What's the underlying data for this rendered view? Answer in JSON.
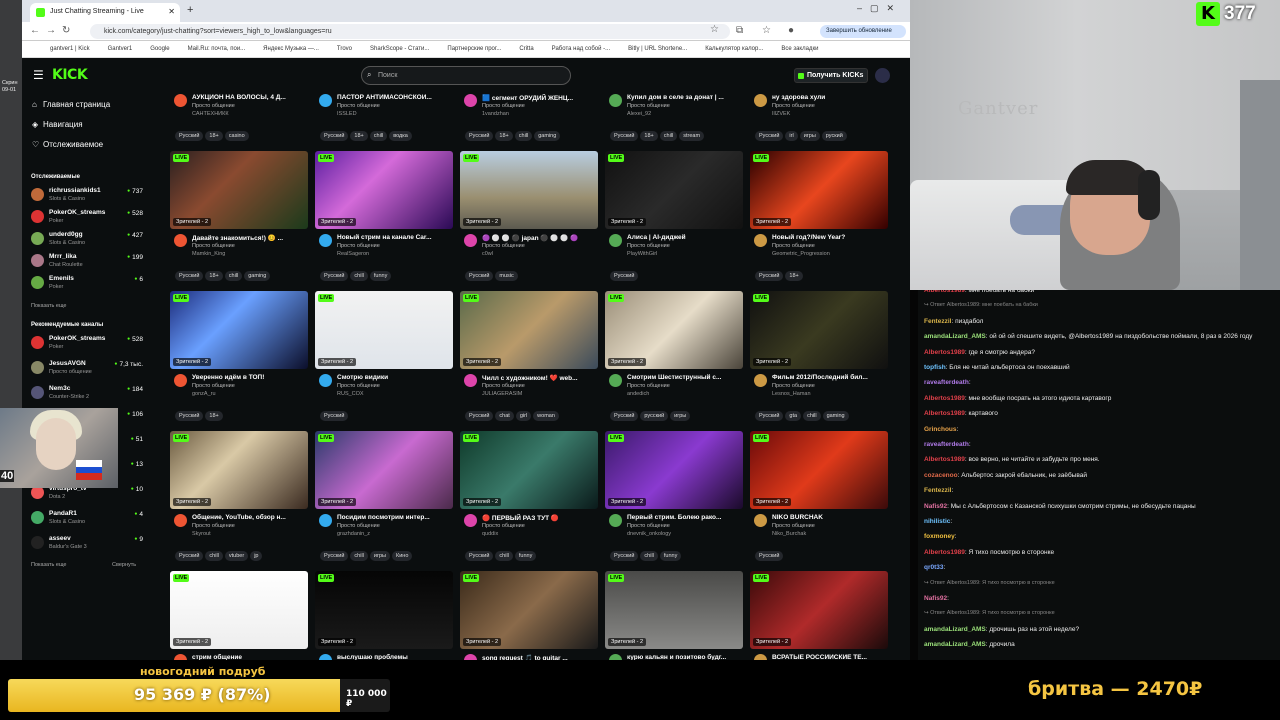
{
  "browser": {
    "tab_title": "Just Chatting Streaming - Live",
    "url": "kick.com/category/just-chatting?sort=viewers_high_to_low&languages=ru",
    "update_button": "Завершить обновление",
    "bookmarks": [
      "gantver1 | Kick",
      "Gantver1",
      "Google",
      "Mail.Ru: почта, пои...",
      "Яндекс Музыка —...",
      "Trovo",
      "SharkScope - Стати...",
      "Партнерские прог...",
      "Critta",
      "Работа над собой -...",
      "Bitly | URL Shortene...",
      "Калькулятор калор...",
      "Все закладки"
    ]
  },
  "kick": {
    "search_placeholder": "Поиск",
    "get_kicks": "Получить KICKs",
    "nav": {
      "home": "Главная страница",
      "browse": "Навигация",
      "following": "Отслеживаемое"
    },
    "following_header": "Отслеживаемые",
    "following": [
      {
        "name": "richrussiankids1",
        "game": "Slots & Casino",
        "viewers": "737",
        "color": "#c06a3a"
      },
      {
        "name": "PokerOK_streams",
        "game": "Poker",
        "viewers": "528",
        "color": "#d33"
      },
      {
        "name": "underd0gg",
        "game": "Slots & Casino",
        "viewers": "427",
        "color": "#7a5"
      },
      {
        "name": "Mrrr_lika",
        "game": "Chat Roulette",
        "viewers": "199",
        "color": "#a78"
      },
      {
        "name": "Emenils",
        "game": "Poker",
        "viewers": "6",
        "color": "#6a4"
      }
    ],
    "show_more": "Показать еще",
    "recommended_header": "Рекомендуемые каналы",
    "recommended": [
      {
        "name": "PokerOK_streams",
        "game": "Poker",
        "viewers": "528",
        "color": "#d33"
      },
      {
        "name": "JesusAVGN",
        "game": "Просто общение",
        "viewers": "7,3 тыс.",
        "color": "#886"
      },
      {
        "name": "Nem3c",
        "game": "Counter-Strike 2",
        "viewers": "184",
        "color": "#557"
      },
      {
        "name": "",
        "game": "",
        "viewers": "106",
        "color": "#444"
      },
      {
        "name": "",
        "game": "",
        "viewers": "51",
        "color": "#444"
      },
      {
        "name": "",
        "game": "",
        "viewers": "13",
        "color": "#444"
      },
      {
        "name": "virtuspro_tv",
        "game": "Dota 2",
        "viewers": "10",
        "color": "#e55"
      },
      {
        "name": "PandaR1",
        "game": "Slots & Casino",
        "viewers": "4",
        "color": "#4a6"
      },
      {
        "name": "asseev",
        "game": "Baldur's Gate 3",
        "viewers": "9",
        "color": "#222"
      }
    ],
    "show_more2": "Показать еще",
    "collapse": "Свернуть",
    "live_label": "LIVE",
    "viewers_label": "Зрителей - 2",
    "category": "Просто общение",
    "top_row": [
      {
        "title": "АУКЦИОН НА ВОЛОСЫ, 4 Д...",
        "user": "САНТЕХНИКК",
        "tags": [
          "Русский",
          "18+",
          "casino"
        ]
      },
      {
        "title": "ПАСТОР АНТИМАСОНСКОЙ...",
        "user": "ISSLED",
        "tags": [
          "Русский",
          "18+",
          "chill",
          "водка"
        ]
      },
      {
        "title": "🟦 сегмент ОРУДИЙ ЖЕНЦ...",
        "user": "1vandzhan",
        "tags": [
          "Русский",
          "18+",
          "chill",
          "gaming"
        ]
      },
      {
        "title": "Купил дом в селе за донат | ...",
        "user": "Alexei_92",
        "tags": [
          "Русский",
          "18+",
          "chill",
          "stream"
        ]
      },
      {
        "title": "ну здорова хули",
        "user": "IllZVEK",
        "tags": [
          "Русский",
          "irl",
          "игры",
          "руский"
        ]
      }
    ],
    "cards": [
      {
        "title": "Давайте знакомиться!) 😊 ...",
        "user": "Mamkin_King",
        "tags": [
          "Русский",
          "18+",
          "chill",
          "gaming"
        ]
      },
      {
        "title": "Новый стрим на канале Car...",
        "user": "RealSageron",
        "tags": [
          "Русский",
          "chill",
          "funny"
        ]
      },
      {
        "title": "🟣 ⚪ ⚪ ⚫ japan ⚫ ⚪ ⚪ 🟣",
        "user": "c0wl",
        "tags": [
          "Русский",
          "music"
        ]
      },
      {
        "title": "Алиса | AI-диджей",
        "user": "PlayWithGirl",
        "tags": [
          "Русский"
        ]
      },
      {
        "title": "Новый год?/New Year?",
        "user": "Geometric_Progression",
        "tags": [
          "Русский",
          "18+"
        ]
      },
      {
        "title": "Уверенно идём в ТОП!",
        "user": "gonzA_ru",
        "tags": [
          "Русский",
          "18+"
        ]
      },
      {
        "title": "Смотрю видики",
        "user": "RUS_COX",
        "tags": [
          "Русский"
        ]
      },
      {
        "title": "Чилл с художником! ❤️ web...",
        "user": "JULIAGERASIM",
        "tags": [
          "Русский",
          "chat",
          "girl",
          "woman"
        ]
      },
      {
        "title": "Смотрим Шестиструнный с...",
        "user": "andedich",
        "tags": [
          "Русский",
          "русский",
          "игры"
        ]
      },
      {
        "title": "Фильм 2012/Последний бил...",
        "user": "Lesnos_Haman",
        "tags": [
          "Русский",
          "gta",
          "chill",
          "gaming"
        ]
      },
      {
        "title": "Общение, YouTube, обзор н...",
        "user": "Skyrout",
        "tags": [
          "Русский",
          "chill",
          "vtuber",
          "jp"
        ]
      },
      {
        "title": "Посидим посмотрим интер...",
        "user": "grazhdanin_z",
        "tags": [
          "Русский",
          "chill",
          "игры",
          "Кино"
        ]
      },
      {
        "title": "🔴 ПЕРВЫЙ РАЗ ТУТ 🔴",
        "user": "quddix",
        "tags": [
          "Русский",
          "chill",
          "funny"
        ]
      },
      {
        "title": "Первый стрим. Болею рако...",
        "user": "dnevnik_onkology",
        "tags": [
          "Русский",
          "chill",
          "funny"
        ]
      },
      {
        "title": "NIKO BURCHAK",
        "user": "Niko_Burchak",
        "tags": [
          "Русский"
        ]
      },
      {
        "title": "стрим общение",
        "user": "",
        "tags": []
      },
      {
        "title": "выслушаю проблемы",
        "user": "",
        "tags": []
      },
      {
        "title": "song request 🎵 to guitar ...",
        "user": "",
        "tags": []
      },
      {
        "title": "курю кальян и позитово будг...",
        "user": "",
        "tags": []
      },
      {
        "title": "ВСРАТЫЕ РОССИЙСКИЕ ТЕ...",
        "user": "",
        "tags": []
      }
    ]
  },
  "overlay": {
    "kicks_count": "377",
    "webcam_text": "Gantver",
    "mini_count": "40",
    "side_label": "Скрин 09-01",
    "goal_title": "новогодний подруб",
    "goal_amount": "95 369 ₽ (87%)",
    "goal_progress": 0.87,
    "goal_target": "110 000 ₽",
    "promo": "бритва — 2470₽"
  },
  "chat": [
    {
      "user": "Albertos1989",
      "color": "#e0404a",
      "text": ": мне поебать на бабки",
      "reply": false
    },
    {
      "user": "",
      "color": "#888",
      "text": "↪ Ответ Albertos1989: мне поебать на бабки",
      "reply": true
    },
    {
      "user": "Fentezzil",
      "color": "#d8b34a",
      "text": ": пиздабол",
      "reply": false
    },
    {
      "user": "amandaLizard_AMS",
      "color": "#9be07a",
      "text": ": ой ой ой спешите видеть, @Albertos1989 на пиздобольстве поймали, 8 раз в 2026 году",
      "reply": false
    },
    {
      "user": "Albertos1989",
      "color": "#e0404a",
      "text": ": где я смотрю андера?",
      "reply": false
    },
    {
      "user": "topfish",
      "color": "#6ec3ff",
      "text": ": Бля не читай альбертоса он поехавший",
      "reply": false
    },
    {
      "user": "raveafterdeath",
      "color": "#b07ae8",
      "text": ":",
      "reply": false
    },
    {
      "user": "Albertos1989",
      "color": "#e0404a",
      "text": ": мне вообще посрать на этого идиота картавогр",
      "reply": false
    },
    {
      "user": "Albertos1989",
      "color": "#e0404a",
      "text": ": картавого",
      "reply": false
    },
    {
      "user": "Grinchous",
      "color": "#e8a34a",
      "text": ":",
      "reply": false
    },
    {
      "user": "raveafterdeath",
      "color": "#b07ae8",
      "text": ":",
      "reply": false
    },
    {
      "user": "Albertos1989",
      "color": "#e0404a",
      "text": ": все верно, не читайте и забудьте про меня.",
      "reply": false
    },
    {
      "user": "cozacenoo",
      "color": "#e06a4a",
      "text": ": Альбертос закрой ебальник, не заёбывай",
      "reply": false
    },
    {
      "user": "Fentezzil",
      "color": "#d8b34a",
      "text": ":",
      "reply": false
    },
    {
      "user": "Nafis92",
      "color": "#e070a0",
      "text": ": Мы с Альбертосом с Казанской психушки смотрим стримы, не обесудьте пацаны",
      "reply": false
    },
    {
      "user": "nihilistic",
      "color": "#6ec3ff",
      "text": ":",
      "reply": false
    },
    {
      "user": "foxmoney",
      "color": "#f0c040",
      "text": ":",
      "reply": false
    },
    {
      "user": "Albertos1989",
      "color": "#e0404a",
      "text": ": Я тихо посмотрю в сторонке",
      "reply": false
    },
    {
      "user": "qr0t33",
      "color": "#7aa8ff",
      "text": ":",
      "reply": false
    },
    {
      "user": "",
      "color": "#888",
      "text": "↪ Ответ Albertos1989: Я тихо посмотрю в сторонке",
      "reply": true
    },
    {
      "user": "Nafis92",
      "color": "#e070a0",
      "text": ":",
      "reply": false
    },
    {
      "user": "",
      "color": "#888",
      "text": "↪ Ответ Albertos1989: Я тихо посмотрю в сторонке",
      "reply": true
    },
    {
      "user": "amandaLizard_AMS",
      "color": "#9be07a",
      "text": ": дрочишь раз на этой неделе?",
      "reply": false
    },
    {
      "user": "amandaLizard_AMS",
      "color": "#9be07a",
      "text": ": дрочила",
      "reply": false
    }
  ]
}
